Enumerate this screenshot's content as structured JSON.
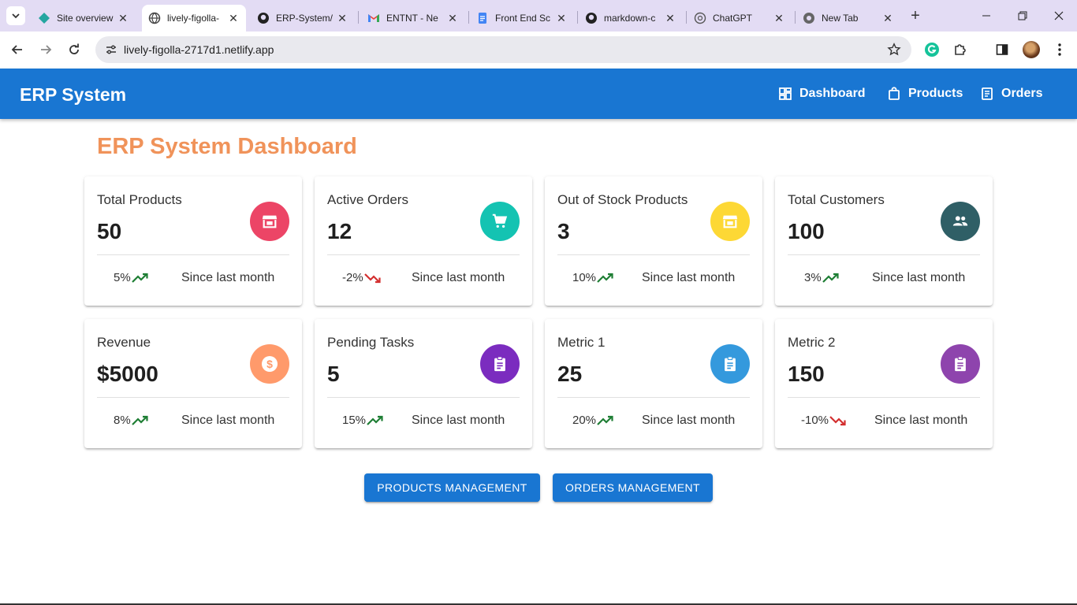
{
  "browser": {
    "tabs": [
      {
        "title": "Site overview",
        "icon": "netlify-icon",
        "active": false
      },
      {
        "title": "lively-figolla-",
        "icon": "globe-icon",
        "active": true
      },
      {
        "title": "ERP-System/",
        "icon": "github-icon",
        "active": false
      },
      {
        "title": "ENTNT - Ne",
        "icon": "gmail-icon",
        "active": false
      },
      {
        "title": "Front End Sc",
        "icon": "docs-icon",
        "active": false
      },
      {
        "title": "markdown-c",
        "icon": "github-icon",
        "active": false
      },
      {
        "title": "ChatGPT",
        "icon": "chatgpt-icon",
        "active": false
      },
      {
        "title": "New Tab",
        "icon": "chrome-icon",
        "active": false
      }
    ],
    "url": "lively-figolla-2717d1.netlify.app"
  },
  "appbar": {
    "brand": "ERP System",
    "nav": [
      {
        "label": "Dashboard",
        "icon": "dashboard-icon"
      },
      {
        "label": "Products",
        "icon": "shopping-bag-icon"
      },
      {
        "label": "Orders",
        "icon": "receipt-icon"
      }
    ]
  },
  "page": {
    "title": "ERP System Dashboard"
  },
  "cards": [
    {
      "label": "Total Products",
      "value": "50",
      "change": "5%",
      "direction": "up",
      "since": "Since last month",
      "icon": "store-icon",
      "color": "#ec4566"
    },
    {
      "label": "Active Orders",
      "value": "12",
      "change": "-2%",
      "direction": "down",
      "since": "Since last month",
      "icon": "cart-icon",
      "color": "#14c3b2"
    },
    {
      "label": "Out of Stock Products",
      "value": "3",
      "change": "10%",
      "direction": "up",
      "since": "Since last month",
      "icon": "store-icon",
      "color": "#fdd835"
    },
    {
      "label": "Total Customers",
      "value": "100",
      "change": "3%",
      "direction": "up",
      "since": "Since last month",
      "icon": "people-icon",
      "color": "#2f5f66"
    },
    {
      "label": "Revenue",
      "value": "$5000",
      "change": "8%",
      "direction": "up",
      "since": "Since last month",
      "icon": "dollar-icon",
      "color": "#ff9a6b"
    },
    {
      "label": "Pending Tasks",
      "value": "5",
      "change": "15%",
      "direction": "up",
      "since": "Since last month",
      "icon": "clipboard-icon",
      "color": "#7b2cbf"
    },
    {
      "label": "Metric 1",
      "value": "25",
      "change": "20%",
      "direction": "up",
      "since": "Since last month",
      "icon": "clipboard-icon",
      "color": "#3499dd"
    },
    {
      "label": "Metric 2",
      "value": "150",
      "change": "-10%",
      "direction": "down",
      "since": "Since last month",
      "icon": "clipboard-icon",
      "color": "#8e44ad"
    }
  ],
  "actions": {
    "products_label": "PRODUCTS MANAGEMENT",
    "orders_label": "ORDERS MANAGEMENT"
  },
  "colors": {
    "primary": "#1976d2",
    "title": "#f0935a",
    "trend_up": "#1e7e34",
    "trend_down": "#d32f2f"
  }
}
